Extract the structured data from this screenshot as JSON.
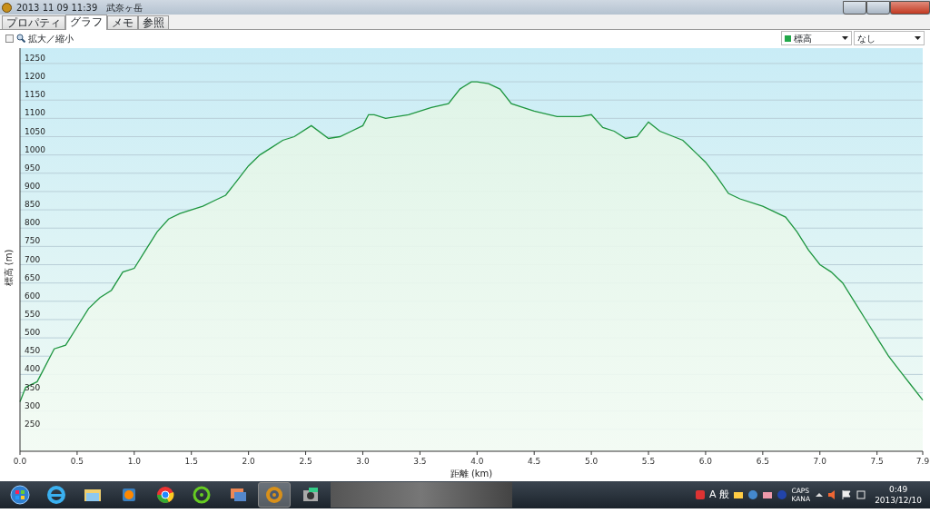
{
  "window": {
    "title": "2013 11 09 11:39",
    "subtitle": "武奈ヶ岳"
  },
  "tabs": [
    {
      "label": "プロパティ",
      "selected": false
    },
    {
      "label": "グラフ",
      "selected": true
    },
    {
      "label": "メモ",
      "selected": false
    },
    {
      "label": "参照",
      "selected": false
    }
  ],
  "zoom_checkbox": {
    "label": "拡大／縮小",
    "checked": false
  },
  "series_select": {
    "color": "#22a84a"
  },
  "compare_select": {
    "value": "なし"
  },
  "chart_data": {
    "type": "area",
    "grid": true,
    "xlabel": "距離 (km)",
    "ylabel": "標高 (m)",
    "x": [
      0,
      0.05,
      0.15,
      0.2,
      0.3,
      0.4,
      0.5,
      0.6,
      0.7,
      0.8,
      0.9,
      1.0,
      1.1,
      1.2,
      1.3,
      1.4,
      1.5,
      1.6,
      1.7,
      1.8,
      1.9,
      2.0,
      2.1,
      2.2,
      2.3,
      2.4,
      2.55,
      2.7,
      2.8,
      2.9,
      3.0,
      3.05,
      3.1,
      3.2,
      3.4,
      3.6,
      3.75,
      3.85,
      3.95,
      4.0,
      4.1,
      4.2,
      4.3,
      4.5,
      4.7,
      4.9,
      5.0,
      5.1,
      5.2,
      5.3,
      5.4,
      5.5,
      5.6,
      5.8,
      5.9,
      6.0,
      6.1,
      6.2,
      6.3,
      6.5,
      6.6,
      6.7,
      6.8,
      6.9,
      7.0,
      7.1,
      7.2,
      7.3,
      7.4,
      7.5,
      7.6,
      7.7,
      7.8,
      7.9
    ],
    "series": [
      {
        "name": "標高",
        "color": "#1e9640",
        "values": [
          325,
          365,
          380,
          410,
          470,
          480,
          530,
          580,
          610,
          630,
          680,
          690,
          740,
          790,
          825,
          840,
          850,
          860,
          875,
          890,
          930,
          970,
          1000,
          1020,
          1040,
          1050,
          1080,
          1045,
          1050,
          1065,
          1080,
          1110,
          1110,
          1100,
          1110,
          1130,
          1140,
          1180,
          1200,
          1200,
          1195,
          1180,
          1140,
          1120,
          1105,
          1105,
          1110,
          1075,
          1065,
          1045,
          1050,
          1090,
          1065,
          1040,
          1010,
          980,
          940,
          895,
          880,
          860,
          845,
          830,
          790,
          740,
          700,
          680,
          650,
          600,
          550,
          500,
          450,
          410,
          370,
          330
        ]
      }
    ],
    "xlim": [
      0,
      7.9
    ],
    "ylim": [
      190,
      1292
    ],
    "xticks": [
      {
        "value": 0,
        "label": "0.0"
      },
      0.5,
      {
        "value": 1,
        "label": "1.0"
      },
      1.5,
      {
        "value": 2,
        "label": "2.0"
      },
      2.5,
      {
        "value": 3,
        "label": "3.0"
      },
      3.5,
      {
        "value": 4,
        "label": "4.0"
      },
      4.5,
      {
        "value": 5,
        "label": "5.0"
      },
      5.5,
      {
        "value": 6,
        "label": "6.0"
      },
      6.5,
      {
        "value": 7,
        "label": "7.0"
      },
      7.5,
      7.9
    ],
    "yticks": [
      250,
      300,
      350,
      400,
      450,
      500,
      550,
      600,
      650,
      700,
      750,
      800,
      850,
      900,
      950,
      1000,
      1050,
      1100,
      1150,
      1200,
      1250
    ]
  },
  "taskbar": {
    "apps": [
      {
        "kind": "start",
        "selected": false
      },
      {
        "kind": "browser",
        "selected": false
      },
      {
        "kind": "folder",
        "selected": false
      },
      {
        "kind": "media",
        "selected": false
      },
      {
        "kind": "chrome",
        "selected": false
      },
      {
        "kind": "ring",
        "selected": false
      },
      {
        "kind": "photos",
        "selected": false
      },
      {
        "kind": "target",
        "selected": true
      },
      {
        "kind": "camera",
        "selected": false
      }
    ],
    "ime": "A",
    "ime_mode": "般",
    "caps": "CAPS",
    "kana": "KANA",
    "time": "0:49",
    "date": "2013/12/10"
  }
}
